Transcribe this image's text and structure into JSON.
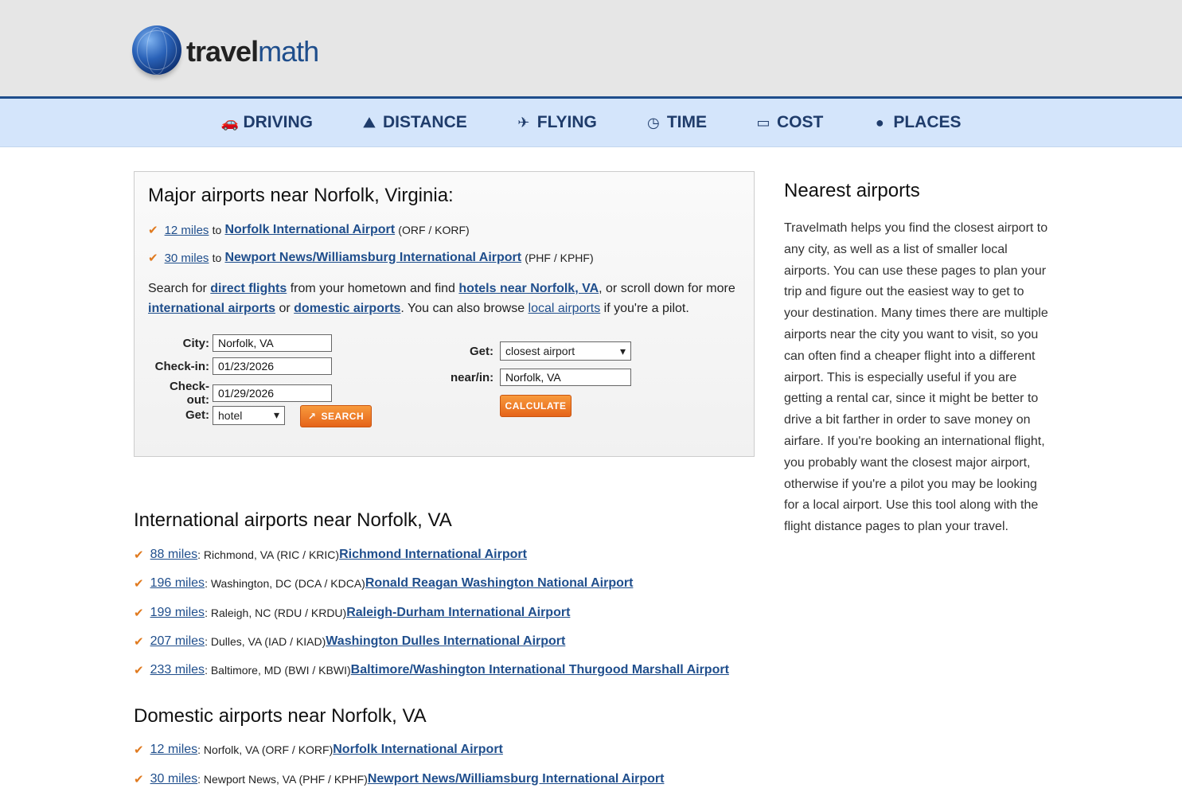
{
  "logo": {
    "part1": "travel",
    "part2": "math"
  },
  "nav": [
    {
      "label": "DRIVING",
      "icon": "car-icon",
      "glyph": "🚗"
    },
    {
      "label": "DISTANCE",
      "icon": "road-icon",
      "glyph": "⛰"
    },
    {
      "label": "FLYING",
      "icon": "plane-icon",
      "glyph": "✈"
    },
    {
      "label": "TIME",
      "icon": "clock-icon",
      "glyph": "◷"
    },
    {
      "label": "COST",
      "icon": "credit-card-icon",
      "glyph": "▭"
    },
    {
      "label": "PLACES",
      "icon": "globe-icon",
      "glyph": "●"
    }
  ],
  "major": {
    "title": "Major airports near Norfolk, Virginia:",
    "items": [
      {
        "dist": "12 miles",
        "to": "to",
        "name": "Norfolk International Airport",
        "codes": "(ORF / KORF)"
      },
      {
        "dist": "30 miles",
        "to": "to",
        "name": "Newport News/Williamsburg International Airport",
        "codes": "(PHF / KPHF)"
      }
    ],
    "para": {
      "t1": "Search for ",
      "l1": "direct flights",
      "t2": " from your hometown and find ",
      "l2": "hotels near Norfolk, VA",
      "t3": ", or scroll down for more ",
      "l3": "international airports",
      "t4": " or ",
      "l4": "domestic airports",
      "t5": ". You can also browse ",
      "l5": "local airports",
      "t6": " if you're a pilot."
    }
  },
  "hotel_form": {
    "city_label": "City:",
    "city_value": "Norfolk, VA",
    "checkin_label": "Check-in:",
    "checkin_value": "01/23/2026",
    "checkout_label": "Check-out:",
    "checkout_value": "01/29/2026",
    "get_label": "Get:",
    "get_value": "hotel",
    "search_label": "SEARCH"
  },
  "airport_form": {
    "get_label": "Get:",
    "get_value": "closest airport",
    "near_label": "near/in:",
    "near_value": "Norfolk, VA",
    "calc_label": "CALCULATE"
  },
  "international": {
    "title": "International airports near Norfolk, VA",
    "items": [
      {
        "dist": "88 miles",
        "info": ": Richmond, VA (RIC / KRIC) ",
        "name": "Richmond International Airport"
      },
      {
        "dist": "196 miles",
        "info": ": Washington, DC (DCA / KDCA) ",
        "name": "Ronald Reagan Washington National Airport"
      },
      {
        "dist": "199 miles",
        "info": ": Raleigh, NC (RDU / KRDU) ",
        "name": "Raleigh-Durham International Airport"
      },
      {
        "dist": "207 miles",
        "info": ": Dulles, VA (IAD / KIAD) ",
        "name": "Washington Dulles International Airport"
      },
      {
        "dist": "233 miles",
        "info": ": Baltimore, MD (BWI / KBWI) ",
        "name": "Baltimore/Washington International Thurgood Marshall Airport"
      }
    ]
  },
  "domestic": {
    "title": "Domestic airports near Norfolk, VA",
    "items": [
      {
        "dist": "12 miles",
        "info": ": Norfolk, VA (ORF / KORF) ",
        "name": "Norfolk International Airport"
      },
      {
        "dist": "30 miles",
        "info": ": Newport News, VA (PHF / KPHF) ",
        "name": "Newport News/Williamsburg International Airport"
      }
    ]
  },
  "sidebar": {
    "title": "Nearest airports",
    "text": "Travelmath helps you find the closest airport to any city, as well as a list of smaller local airports. You can use these pages to plan your trip and figure out the easiest way to get to your destination. Many times there are multiple airports near the city you want to visit, so you can often find a cheaper flight into a different airport. This is especially useful if you are getting a rental car, since it might be better to drive a bit farther in order to save money on airfare. If you're booking an international flight, you probably want the closest major airport, otherwise if you're a pilot you may be looking for a local airport. Use this tool along with the flight distance pages to plan your travel."
  },
  "check_glyph": "✔",
  "select_arrow": "▾",
  "search_icon_glyph": "↗"
}
